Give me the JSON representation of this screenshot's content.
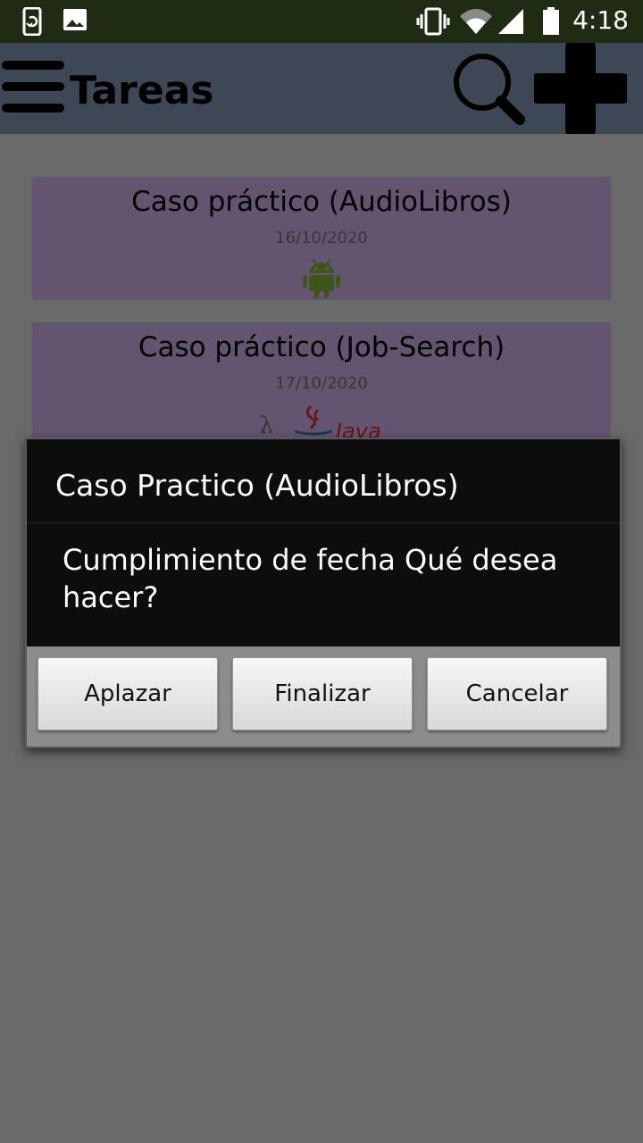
{
  "status_bar": {
    "time": "4:18",
    "icons": [
      "phone-sync-icon",
      "image-icon",
      "vibrate-icon",
      "wifi-icon",
      "signal-icon",
      "battery-icon"
    ]
  },
  "toolbar": {
    "title": "Tareas",
    "icons": [
      "menu-icon",
      "search-icon",
      "add-icon"
    ]
  },
  "tasks": [
    {
      "title": "Caso práctico (AudioLibros)",
      "date": "16/10/2020",
      "icon": "android-icon"
    },
    {
      "title": "Caso práctico (Job-Search)",
      "date": "17/10/2020",
      "icon": "java-logo",
      "logo_text": "Java"
    }
  ],
  "dialog": {
    "title": "Caso Practico (AudioLibros)",
    "message": "Cumplimiento de fecha Qué desea hacer?",
    "buttons": [
      "Aplazar",
      "Finalizar",
      "Cancelar"
    ]
  },
  "colors": {
    "status_bar": "#1f2b12",
    "toolbar": "#7b8eaa",
    "card": "#c7a8e0",
    "background": "#d3d3d3",
    "dialog": "#0d0d0d"
  }
}
